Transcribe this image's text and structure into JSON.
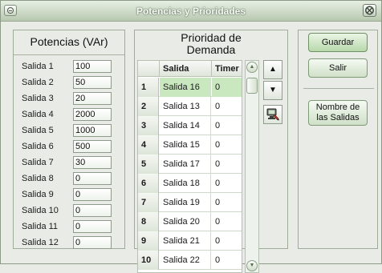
{
  "window": {
    "title": "Potencias y Prioridades",
    "close_glyph": "⨂"
  },
  "potencias": {
    "title": "Potencias (VAr)",
    "rows": [
      {
        "label": "Salida 1",
        "value": "100"
      },
      {
        "label": "Salida 2",
        "value": "50"
      },
      {
        "label": "Salida 3",
        "value": "20"
      },
      {
        "label": "Salida 4",
        "value": "2000"
      },
      {
        "label": "Salida 5",
        "value": "1000"
      },
      {
        "label": "Salida 6",
        "value": "500"
      },
      {
        "label": "Salida 7",
        "value": "30"
      },
      {
        "label": "Salida 8",
        "value": "0"
      },
      {
        "label": "Salida 9",
        "value": "0"
      },
      {
        "label": "Salida 10",
        "value": "0"
      },
      {
        "label": "Salida 11",
        "value": "0"
      },
      {
        "label": "Salida 12",
        "value": "0"
      }
    ]
  },
  "prioridad": {
    "title_line1": "Prioridad de",
    "title_line2": "Demanda",
    "columns": {
      "salida": "Salida",
      "timer": "Timer"
    },
    "rows": [
      {
        "num": "1",
        "salida": "Salida 16",
        "timer": "0"
      },
      {
        "num": "2",
        "salida": "Salida 13",
        "timer": "0"
      },
      {
        "num": "3",
        "salida": "Salida 14",
        "timer": "0"
      },
      {
        "num": "4",
        "salida": "Salida 15",
        "timer": "0"
      },
      {
        "num": "5",
        "salida": "Salida 17",
        "timer": "0"
      },
      {
        "num": "6",
        "salida": "Salida 18",
        "timer": "0"
      },
      {
        "num": "7",
        "salida": "Salida 19",
        "timer": "0"
      },
      {
        "num": "8",
        "salida": "Salida 20",
        "timer": "0"
      },
      {
        "num": "9",
        "salida": "Salida 21",
        "timer": "0"
      },
      {
        "num": "10",
        "salida": "Salida 22",
        "timer": "0"
      }
    ],
    "up_glyph": "▲",
    "down_glyph": "▼"
  },
  "actions": {
    "guardar": "Guardar",
    "salir": "Salir",
    "nombre_line1": "Nombre de",
    "nombre_line2": "las Salidas"
  },
  "icons": {
    "window_menu": "window-menu-icon",
    "close": "close-icon",
    "move_up": "arrow-up-icon",
    "move_down": "arrow-down-icon",
    "edit": "computer-edit-icon"
  },
  "colors": {
    "accent": "#b8d8ab",
    "selected_row": "#c9e8bf",
    "background": "#e9ece6"
  }
}
